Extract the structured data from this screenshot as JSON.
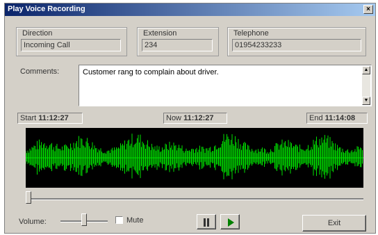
{
  "window": {
    "title": "Play Voice Recording",
    "close_glyph": "×"
  },
  "fields": {
    "direction": {
      "label": "Direction",
      "value": "Incoming Call"
    },
    "extension": {
      "label": "Extension",
      "value": "234"
    },
    "telephone": {
      "label": "Telephone",
      "value": "01954233233"
    }
  },
  "comments": {
    "label": "Comments:",
    "text": "Customer rang to complain about driver."
  },
  "times": {
    "start_label": "Start",
    "start_value": "11:12:27",
    "now_label": "Now",
    "now_value": "11:12:27",
    "end_label": "End",
    "end_value": "11:14:08"
  },
  "controls": {
    "volume_label": "Volume:",
    "mute_label": "Mute",
    "exit_label": "Exit"
  },
  "playback_position": 0,
  "volume_level": 0.5,
  "colors": {
    "waveform": "#00e000",
    "waveform_bg": "#000000",
    "title_start": "#0a246a",
    "title_end": "#a6caf0"
  }
}
